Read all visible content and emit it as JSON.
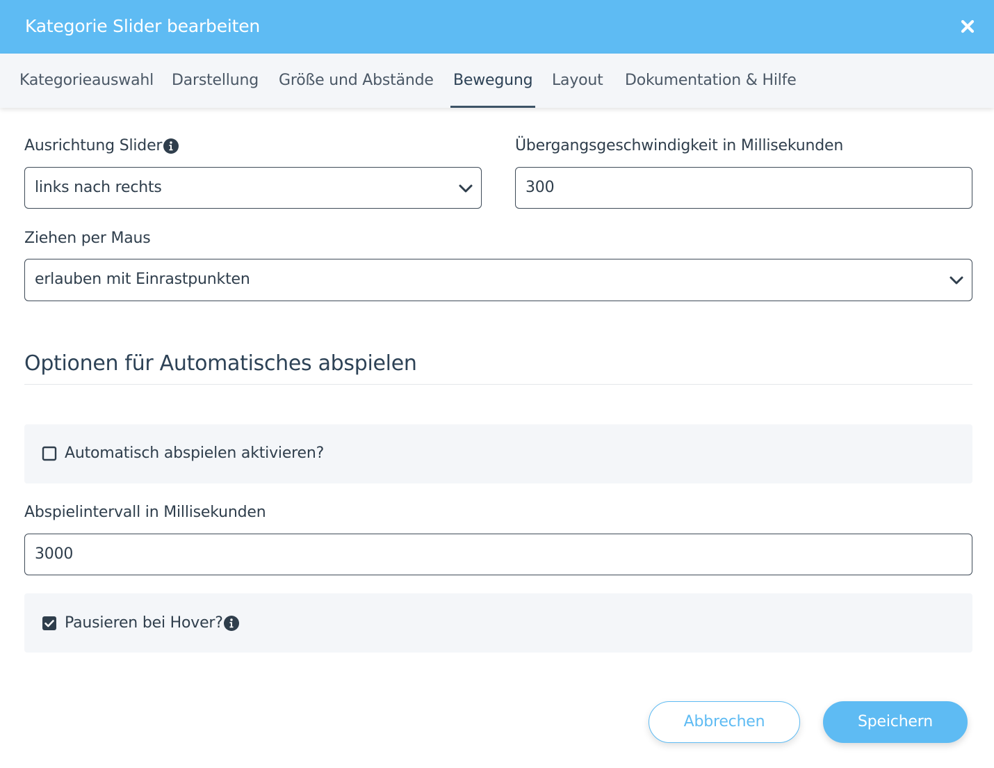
{
  "dialog": {
    "title": "Kategorie Slider bearbeiten",
    "close_icon": "close-icon"
  },
  "tabs": [
    {
      "label": "Kategorieauswahl",
      "active": false
    },
    {
      "label": "Darstellung",
      "active": false
    },
    {
      "label": "Größe und Abstände",
      "active": false
    },
    {
      "label": "Bewegung",
      "active": true
    },
    {
      "label": "Layout",
      "active": false
    },
    {
      "label": "Dokumentation & Hilfe",
      "active": false
    }
  ],
  "form": {
    "orientation": {
      "label": "Ausrichtung Slider",
      "value": "links nach rechts",
      "info_icon": "info-icon"
    },
    "transition_speed": {
      "label": "Übergangsgeschwindigkeit in Millisekunden",
      "value": "300"
    },
    "drag": {
      "label": "Ziehen per Maus",
      "value": "erlauben mit Einrastpunkten"
    }
  },
  "autoplay": {
    "section_title": "Optionen für Automatisches abspielen",
    "enable": {
      "label": "Automatisch abspielen aktivieren?",
      "checked": false
    },
    "interval": {
      "label": "Abspielintervall in Millisekunden",
      "value": "3000"
    },
    "pause_on_hover": {
      "label": "Pausieren bei Hover?",
      "checked": true,
      "info_icon": "info-icon"
    }
  },
  "actions": {
    "cancel_label": "Abbrechen",
    "save_label": "Speichern"
  },
  "colors": {
    "accent": "#5ebbf3",
    "text": "#2f3e4c",
    "panel_bg": "#f4f6f9"
  }
}
